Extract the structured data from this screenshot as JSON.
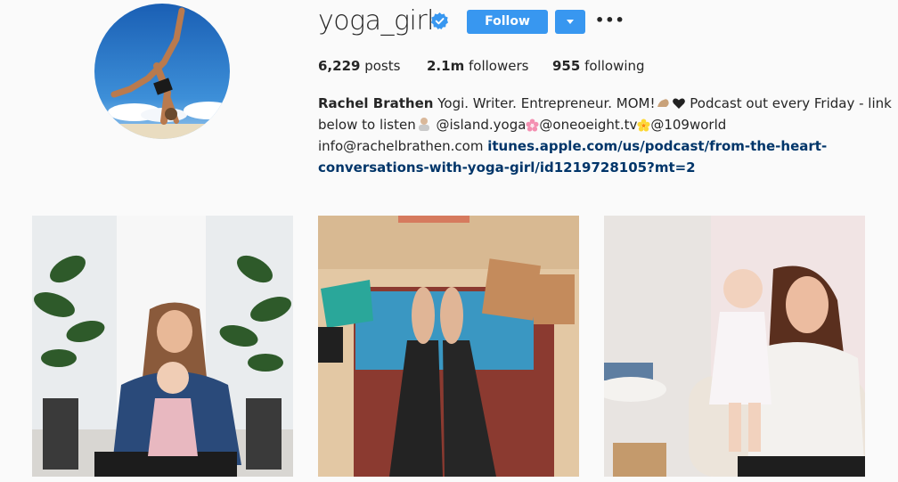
{
  "profile": {
    "username": "yoga_girl",
    "follow_label": "Follow",
    "more_label": "•••"
  },
  "stats": {
    "posts_count": "6,229",
    "posts_label": "posts",
    "followers_count": "2.1m",
    "followers_label": "followers",
    "following_count": "955",
    "following_label": "following"
  },
  "bio": {
    "name": "Rachel Brathen",
    "line1_text": "Yogi. Writer. Entrepreneur. MOM!",
    "line1_tail": "Podcast out every Friday - link",
    "line2_head": "below to listen",
    "mention1": "@island.yoga",
    "mention2": "@oneoeight.tv",
    "mention3": "@109world",
    "email": "info@rachelbrathen.com",
    "url_part1": "itunes.apple.com/us/podcast/from-the-heart-",
    "url_part2": "conversations-with-yoga-girl/id1219728105?mt=2"
  },
  "colors": {
    "accent": "#3897f0",
    "link": "#003569",
    "background": "#fafafa"
  },
  "icons": [
    "verified-badge-icon",
    "chevron-down-icon",
    "more-options-icon"
  ],
  "posts": [
    {
      "name": "post-mother-baby-plants"
    },
    {
      "name": "post-yoga-mat-feet"
    },
    {
      "name": "post-mother-baby-pink"
    }
  ]
}
